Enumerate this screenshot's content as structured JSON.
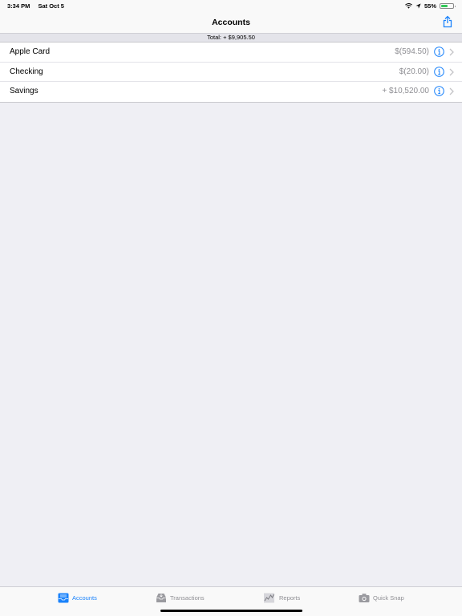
{
  "status_bar": {
    "time": "3:34 PM",
    "date": "Sat Oct 5",
    "battery_percent": "55%",
    "battery_level": 0.55
  },
  "nav": {
    "title": "Accounts"
  },
  "total": {
    "label": "Total:",
    "value": "+ $9,905.50"
  },
  "accounts": [
    {
      "name": "Apple Card",
      "amount": "$(594.50)"
    },
    {
      "name": "Checking",
      "amount": "$(20.00)"
    },
    {
      "name": "Savings",
      "amount": "+ $10,520.00"
    }
  ],
  "tabs": [
    {
      "label": "Accounts",
      "icon": "accounts-tray-icon",
      "active": true
    },
    {
      "label": "Transactions",
      "icon": "transactions-inbox-icon",
      "active": false
    },
    {
      "label": "Reports",
      "icon": "reports-chart-icon",
      "active": false
    },
    {
      "label": "Quick Snap",
      "icon": "camera-icon",
      "active": false
    }
  ],
  "colors": {
    "accent": "#1a82fb",
    "background": "#efeff4",
    "secondary_text": "#8e8e93",
    "battery": "#34c759"
  }
}
